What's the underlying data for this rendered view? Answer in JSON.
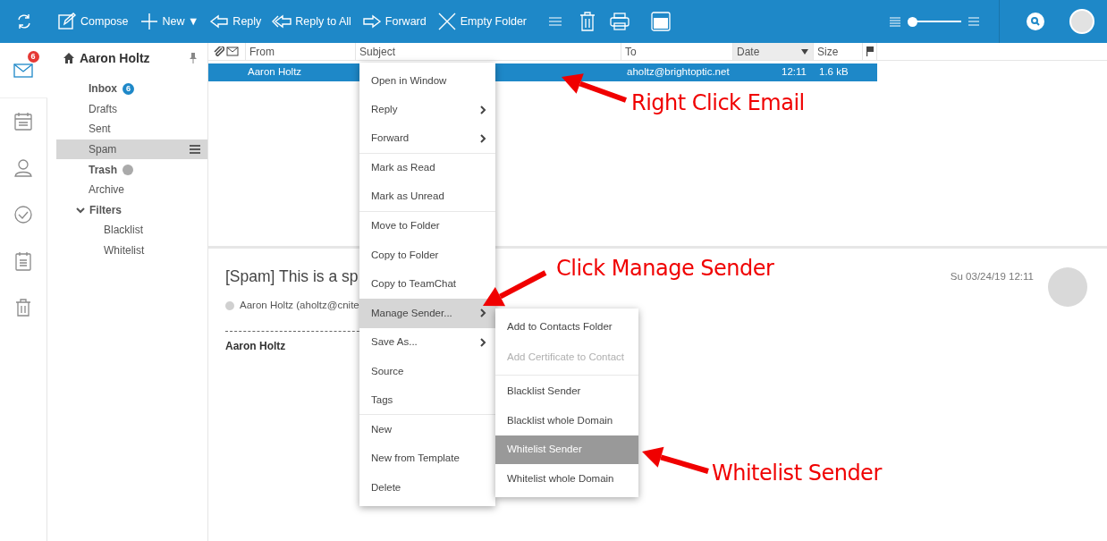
{
  "toolbar": {
    "buttons": [
      {
        "kind": "compose",
        "label": "Compose"
      },
      {
        "kind": "new",
        "label": "New ▼"
      },
      {
        "kind": "reply",
        "label": "Reply"
      },
      {
        "kind": "reply-all",
        "label": "Reply to All"
      },
      {
        "kind": "forward",
        "label": "Forward"
      },
      {
        "kind": "empty",
        "label": "Empty Folder"
      }
    ],
    "zoom_slider": {
      "level": 0.08
    }
  },
  "rail": [
    {
      "kind": "mail",
      "selected": true,
      "badge": "6"
    },
    {
      "kind": "calendar",
      "selected": false
    },
    {
      "kind": "contacts",
      "selected": false
    },
    {
      "kind": "tasks",
      "selected": false
    },
    {
      "kind": "notes",
      "selected": false
    },
    {
      "kind": "trash",
      "selected": false
    }
  ],
  "folders": {
    "account": "Aaron Holtz",
    "items": [
      {
        "label": "Inbox",
        "bold": true,
        "selected": false,
        "badge": "6"
      },
      {
        "label": "Drafts",
        "bold": false,
        "selected": false
      },
      {
        "label": "Sent",
        "bold": false,
        "selected": false
      },
      {
        "label": "Spam",
        "bold": false,
        "selected": true
      },
      {
        "label": "Trash",
        "bold": true,
        "selected": false,
        "info": true
      },
      {
        "label": "Archive",
        "bold": false,
        "selected": false
      },
      {
        "label": "Filters",
        "bold": true,
        "selected": false,
        "expanded": true,
        "children": [
          {
            "label": "Blacklist",
            "bold": false,
            "selected": false
          },
          {
            "label": "Whitelist",
            "bold": false,
            "selected": false
          }
        ]
      }
    ]
  },
  "message_list": {
    "columns": [
      "From",
      "Subject",
      "To",
      "Date",
      "Size"
    ],
    "rows": [
      {
        "from": "Aaron Holtz",
        "to": "aholtz@brightoptic.net",
        "date": "12:11",
        "size": "1.6 kB",
        "selected": true
      }
    ]
  },
  "preview": {
    "subject": "[Spam] This is a sp",
    "sender": "Aaron Holtz (aholtz@cnite",
    "signature": "Aaron Holtz",
    "date": "Su 03/24/19 12:11"
  },
  "context_menu": {
    "items": [
      {
        "label": "Open in Window",
        "submenu": false,
        "selected": false
      },
      {
        "label": "Reply",
        "submenu": true,
        "selected": false
      },
      {
        "label": "Forward",
        "submenu": true,
        "selected": false,
        "divider_after": true
      },
      {
        "label": "Mark as Read",
        "submenu": false,
        "selected": false
      },
      {
        "label": "Mark as Unread",
        "submenu": false,
        "selected": false,
        "divider_after": true
      },
      {
        "label": "Move to Folder",
        "submenu": false,
        "selected": false
      },
      {
        "label": "Copy to Folder",
        "submenu": false,
        "selected": false
      },
      {
        "label": "Copy to TeamChat",
        "submenu": false,
        "selected": false
      },
      {
        "label": "Manage Sender...",
        "submenu": true,
        "selected": true
      },
      {
        "label": "Save As...",
        "submenu": true,
        "selected": false
      },
      {
        "label": "Source",
        "submenu": false,
        "selected": false
      },
      {
        "label": "Tags",
        "submenu": false,
        "selected": false,
        "divider_after": true
      },
      {
        "label": "New",
        "submenu": false,
        "selected": false
      },
      {
        "label": "New from Template",
        "submenu": false,
        "selected": false
      },
      {
        "label": "Delete",
        "submenu": false,
        "selected": false
      }
    ],
    "submenu": [
      {
        "label": "Add to Contacts Folder",
        "disabled": false,
        "selected": false
      },
      {
        "label": "Add Certificate to Contact",
        "disabled": true,
        "selected": false,
        "divider_after": true
      },
      {
        "label": "Blacklist Sender",
        "disabled": false,
        "selected": false
      },
      {
        "label": "Blacklist whole Domain",
        "disabled": false,
        "selected": false
      },
      {
        "label": "Whitelist Sender",
        "disabled": false,
        "selected": true
      },
      {
        "label": "Whitelist whole Domain",
        "disabled": false,
        "selected": false
      }
    ]
  },
  "annotations": [
    "Right Click Email",
    "Click Manage Sender",
    "Whitelist Sender"
  ]
}
